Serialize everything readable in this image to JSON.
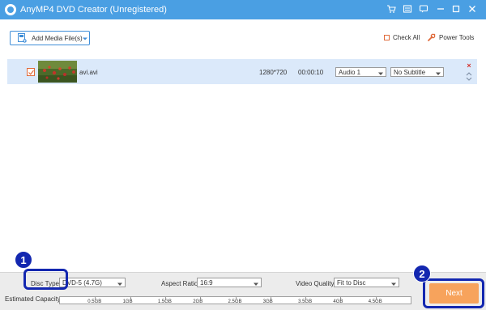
{
  "window": {
    "title": "AnyMP4 DVD Creator (Unregistered)",
    "controls": [
      "cart-icon",
      "menu-icon",
      "chat-icon",
      "minimize-icon",
      "maximize-icon",
      "close-icon"
    ]
  },
  "toolbar": {
    "add_media_label": "Add Media File(s)",
    "check_all_label": "Check All",
    "power_tools_label": "Power Tools"
  },
  "files": [
    {
      "name": "avi.avi",
      "resolution": "1280*720",
      "duration": "00:00:10",
      "audio": "Audio 1",
      "subtitle": "No Subtitle",
      "checked": true
    }
  ],
  "bottom": {
    "disc_type_label": "Disc Type",
    "disc_type_value": "DVD-5 (4.7G)",
    "aspect_ratio_label": "Aspect Ratio:",
    "aspect_ratio_value": "16:9",
    "video_quality_label": "Video Quality:",
    "video_quality_value": "Fit to Disc",
    "estimated_capacity_label": "Estimated Capacity:",
    "capacity_ticks": [
      "0.5GB",
      "1GB",
      "1.5GB",
      "2GB",
      "2.5GB",
      "3GB",
      "3.5GB",
      "4GB",
      "4.5GB"
    ],
    "next_label": "Next"
  },
  "callouts": [
    "1",
    "2"
  ],
  "colors": {
    "titlebar": "#4a9fe3",
    "accent_orange": "#f7a35c",
    "row_highlight": "#dbe9fa",
    "callout": "#1327b0"
  }
}
